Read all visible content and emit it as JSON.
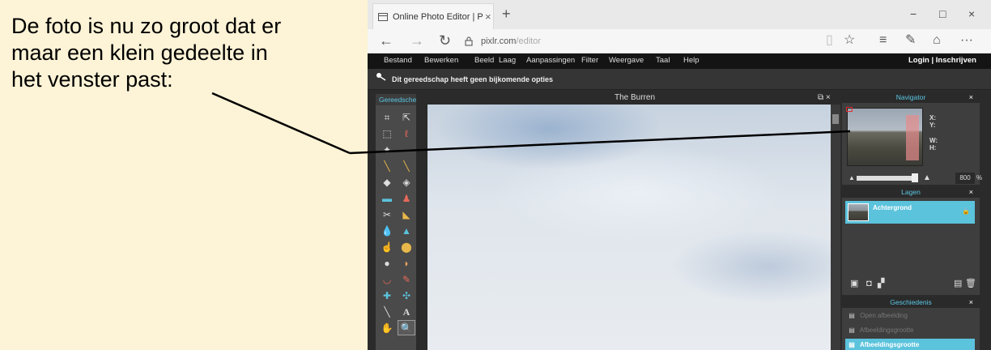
{
  "annotation": {
    "lines": [
      "De foto is nu zo groot dat er",
      "maar een klein gedeelte in",
      "het venster past:"
    ]
  },
  "browser": {
    "tab_title": "Online Photo Editor | Pi:",
    "tab_close": "×",
    "new_tab": "+",
    "url_domain": "pixlr.com",
    "url_path": "/editor",
    "window_controls": {
      "minimize": "−",
      "maximize": "□",
      "close": "×"
    },
    "nav": {
      "back": "←",
      "forward": "→",
      "refresh": "↻",
      "lock": "🔒"
    },
    "right_icons": {
      "reading": "▯",
      "favorite": "☆",
      "hub": "≡",
      "notes": "✎",
      "share": "⌂",
      "more": "···"
    }
  },
  "menu": {
    "items": [
      "Bestand",
      "Bewerken",
      "Beeld",
      "Laag",
      "Aanpassingen",
      "Filter",
      "Weergave",
      "Taal",
      "Help"
    ],
    "login": "Login  |  Inschrijven"
  },
  "options_bar": {
    "text": "Dit gereedschap heeft geen bijkomende opties"
  },
  "tools_panel": {
    "title": "Gereedsche"
  },
  "document": {
    "title": "The Burren",
    "controls": "⧉ ×"
  },
  "navigator": {
    "title": "Navigator",
    "close": "×",
    "labels": [
      "X:",
      "Y:",
      "W:",
      "H:"
    ],
    "zoom_value": "800",
    "zoom_unit": "%"
  },
  "layers": {
    "title": "Lagen",
    "close": "×",
    "items": [
      {
        "name": "Achtergrond"
      }
    ]
  },
  "history": {
    "title": "Geschiedenis",
    "close": "×",
    "items": [
      {
        "name": "Open afbeelding",
        "active": false
      },
      {
        "name": "Afbeeldingsgrootte",
        "active": false
      },
      {
        "name": "Afbeeldingsgrootte",
        "active": true
      }
    ]
  },
  "colors": {
    "accent": "#5bc3dc",
    "background": "#fdf3d6"
  }
}
